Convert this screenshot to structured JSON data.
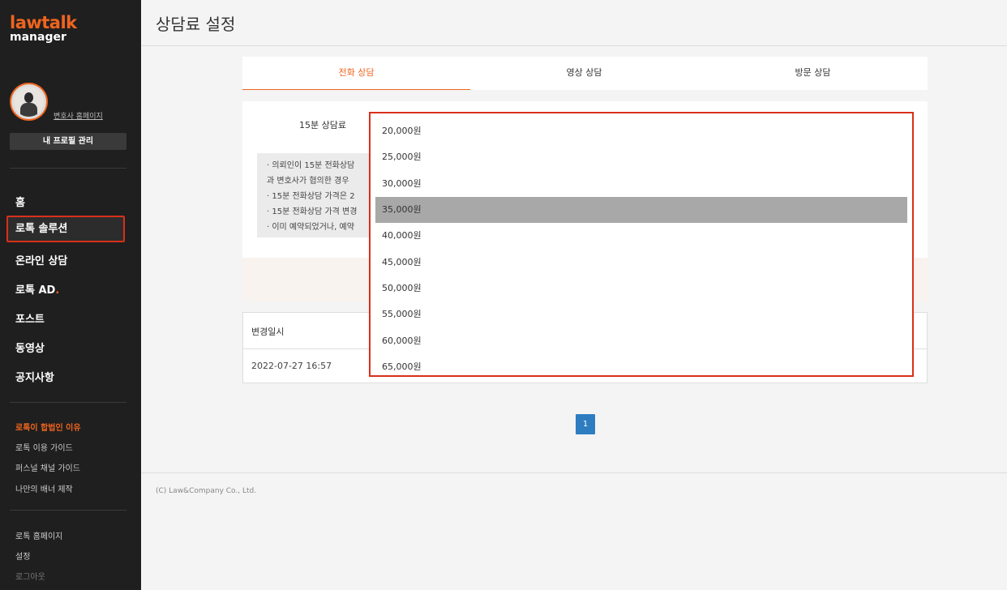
{
  "sidebar": {
    "logo_top": "lawtalk",
    "logo_bottom": "manager",
    "homepage_link": "변호사 홈페이지",
    "profile_button": "내 프로필 관리",
    "menu": [
      "홈",
      "로톡 솔루션",
      "온라인 상담",
      "로톡 AD",
      "포스트",
      "동영상",
      "공지사항"
    ],
    "ad_dot": ".",
    "links": [
      "로톡이 합법인 이유",
      "로톡 이용 가이드",
      "퍼스널 채널 가이드",
      "나만의 배너 제작"
    ],
    "footer_links": [
      "로톡 홈페이지",
      "설정",
      "로그아웃"
    ]
  },
  "header": {
    "title": "상담료 설정"
  },
  "tabs": [
    "전화 상담",
    "영상 상담",
    "방문 상담"
  ],
  "form": {
    "fee_label": "15분 상담료",
    "notice": [
      "·  의뢰인이 15분 전화상담",
      "    과 변호사가 협의한 경우",
      "·  15분 전화상담 가격은 2",
      "·  15분 전화상담 가격 변경",
      "·  이미 예약되었거나, 예약"
    ]
  },
  "table": {
    "header": "변경일시",
    "row_date": "2022-07-27 16:57"
  },
  "pagination": {
    "current": "1"
  },
  "footer": {
    "copyright": "(C) Law&Company Co., Ltd."
  },
  "dropdown": {
    "options": [
      "20,000원",
      "25,000원",
      "30,000원",
      "35,000원",
      "40,000원",
      "45,000원",
      "50,000원",
      "55,000원",
      "60,000원",
      "65,000원"
    ],
    "selected": "35,000원"
  },
  "colors": {
    "accent": "#f0641e",
    "highlight_border": "#d9301a",
    "page_button": "#2e7dc1",
    "sidebar_bg": "#1f1f1f"
  }
}
